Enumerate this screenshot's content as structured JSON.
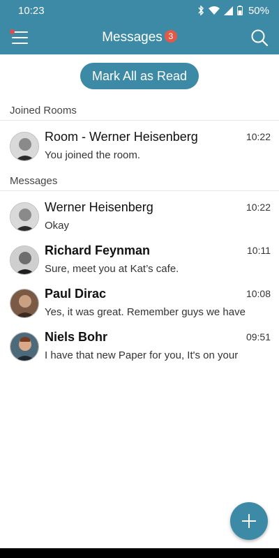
{
  "status_bar": {
    "time": "10:23",
    "battery": "50%"
  },
  "header": {
    "title": "Messages",
    "badge": "3"
  },
  "mark_all_label": "Mark All as Read",
  "sections": {
    "joined_rooms": "Joined Rooms",
    "messages": "Messages"
  },
  "joined_rooms": [
    {
      "name": "Room - Werner Heisenberg",
      "time": "10:22",
      "preview": "You joined the room.",
      "unread": false
    }
  ],
  "messages": [
    {
      "name": "Werner Heisenberg",
      "time": "10:22",
      "preview": "Okay",
      "unread": false
    },
    {
      "name": "Richard Feynman",
      "time": "10:11",
      "preview": "Sure, meet you at Kat’s cafe.",
      "unread": true
    },
    {
      "name": "Paul Dirac",
      "time": "10:08",
      "preview": "Yes, it was great. Remember guys we have",
      "unread": true
    },
    {
      "name": "Niels Bohr",
      "time": "09:51",
      "preview": "I have that new Paper for you, It's on your",
      "unread": true
    }
  ],
  "colors": {
    "accent": "#3d8aa6",
    "badge": "#e05a47"
  },
  "icons": [
    "menu-icon",
    "search-icon",
    "add-icon",
    "wifi-icon",
    "bluetooth-icon",
    "battery-icon"
  ]
}
